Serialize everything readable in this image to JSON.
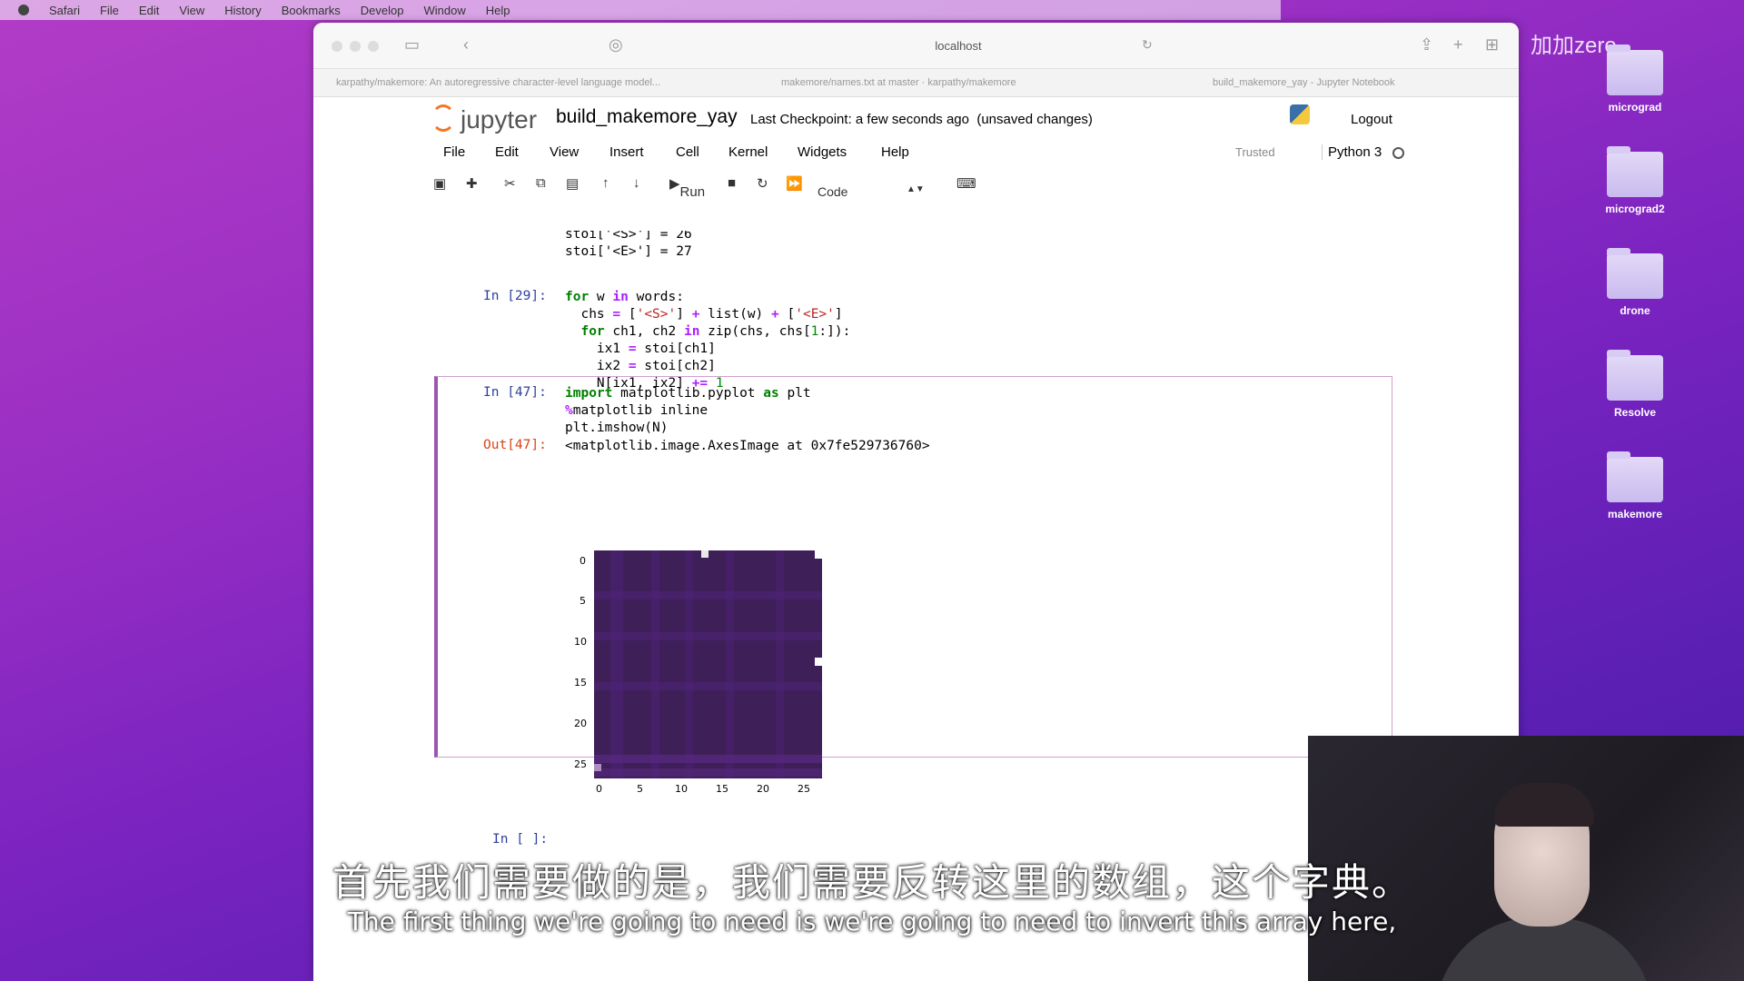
{
  "macos_menu": [
    "Safari",
    "File",
    "Edit",
    "View",
    "History",
    "Bookmarks",
    "Develop",
    "Window",
    "Help"
  ],
  "browser": {
    "url": "localhost",
    "tabs": [
      "karpathy/makemore: An autoregressive character-level language model...",
      "makemore/names.txt at master · karpathy/makemore",
      "build_makemore_yay - Jupyter Notebook"
    ]
  },
  "jupyter": {
    "logo_text": "jupyter",
    "notebook_name": "build_makemore_yay",
    "checkpoint": "Last Checkpoint: a few seconds ago",
    "unsaved": "(unsaved changes)",
    "logout": "Logout",
    "menu": [
      "File",
      "Edit",
      "View",
      "Insert",
      "Cell",
      "Kernel",
      "Widgets",
      "Help"
    ],
    "trusted": "Trusted",
    "kernel": "Python 3",
    "run_label": "Run",
    "cell_type": "Code"
  },
  "cells": {
    "top_code_1": "stoi['<S>'] = 26",
    "top_code_2": "stoi['<E>'] = 27",
    "c29_prompt": "In [29]:",
    "c47_prompt": "In [47]:",
    "c47_out_prompt": "Out[47]:",
    "c47_output": "<matplotlib.image.AxesImage at 0x7fe529736760>",
    "empty_prompt": "In [ ]:"
  },
  "plot": {
    "yticks": [
      "0",
      "5",
      "10",
      "15",
      "20",
      "25"
    ],
    "xticks": [
      "0",
      "5",
      "10",
      "15",
      "20",
      "25"
    ]
  },
  "desktop": {
    "watermark": "加加zero",
    "folders": [
      "micrograd",
      "micrograd2",
      "drone",
      "Resolve",
      "makemore"
    ]
  },
  "subtitles": {
    "cn": "首先我们需要做的是，我们需要反转这里的数组，这个字典。",
    "en": "The first thing we're going to need is we're going to need to invert this array here,"
  }
}
